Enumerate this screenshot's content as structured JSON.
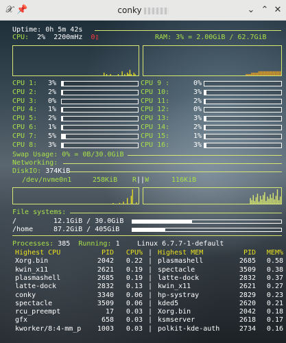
{
  "window": {
    "title": "conky"
  },
  "colors": {
    "label": "#a8e04a",
    "line": "#d8e870",
    "hot": "#e8e020",
    "alert": "#ff3a3a"
  },
  "uptime": {
    "label": "Uptime:",
    "value": "0h 5m 42s"
  },
  "cpu": {
    "label": "CPU:",
    "percent": "2%",
    "freq": "2200mHz",
    "temp": "0"
  },
  "ram": {
    "label": "RAM:",
    "value": "3% = 2.00GiB / 62.7GiB"
  },
  "graphs": {
    "cpu_history": [
      0,
      0,
      0,
      0,
      0,
      0,
      0,
      0,
      0,
      0,
      0,
      0,
      0,
      0,
      0,
      0,
      0,
      0,
      0,
      0,
      0,
      0,
      0,
      0,
      0,
      0,
      0,
      0,
      0,
      0,
      0,
      0,
      0,
      0,
      0,
      0,
      0,
      0,
      0,
      0,
      0,
      0,
      0,
      0,
      0,
      0,
      0,
      0,
      0,
      0,
      0,
      0,
      0,
      0,
      0,
      0,
      0,
      0,
      0,
      0,
      0,
      0,
      0,
      0,
      0,
      0,
      0,
      0,
      0,
      0,
      2,
      0,
      1,
      0,
      0,
      1,
      0,
      0,
      0,
      0,
      0,
      1,
      0,
      0,
      3,
      0,
      1,
      0,
      2,
      1,
      4,
      1,
      0,
      2,
      1,
      0,
      0
    ],
    "ram_history": [
      0,
      0,
      0,
      0,
      0,
      0,
      0,
      0,
      0,
      0,
      0,
      0,
      0,
      0,
      0,
      0,
      0,
      0,
      0,
      0,
      0,
      0,
      0,
      0,
      0,
      0,
      0,
      0,
      0,
      0,
      0,
      0,
      0,
      0,
      0,
      0,
      0,
      0,
      0,
      0,
      0,
      0,
      0,
      0,
      0,
      0,
      0,
      0,
      0,
      0,
      0,
      0,
      0,
      0,
      0,
      0,
      0,
      0,
      0,
      0,
      0,
      0,
      0,
      0,
      0,
      0,
      0,
      0,
      0,
      0,
      0,
      0,
      1,
      1,
      1,
      1,
      2,
      2,
      2,
      2,
      2,
      3,
      3,
      3,
      3,
      3,
      3,
      3,
      3,
      3,
      3,
      3,
      3,
      3,
      3,
      3,
      3
    ],
    "disk_read_history": [
      0,
      0,
      0,
      0,
      0,
      0,
      0,
      0,
      0,
      0,
      0,
      0,
      0,
      0,
      0,
      0,
      0,
      0,
      0,
      0,
      0,
      0,
      0,
      0,
      0,
      0,
      0,
      0,
      0,
      0,
      0,
      0,
      0,
      0,
      0,
      0,
      0,
      0,
      0,
      0,
      0,
      0,
      0,
      0,
      0,
      0,
      0,
      0,
      0,
      0,
      0,
      0,
      0,
      0,
      0,
      0,
      0,
      0,
      0,
      0,
      0,
      0,
      0,
      0,
      0,
      0,
      0,
      0,
      0,
      0,
      0,
      0,
      0,
      0,
      0,
      0,
      0,
      5,
      0,
      0,
      0,
      0,
      6,
      0,
      0,
      15,
      0,
      0,
      40,
      0,
      0,
      55,
      100,
      0,
      0,
      10,
      0
    ],
    "disk_write_history": [
      0,
      0,
      0,
      0,
      0,
      0,
      0,
      0,
      0,
      0,
      0,
      0,
      0,
      0,
      0,
      0,
      0,
      0,
      0,
      0,
      0,
      0,
      0,
      0,
      0,
      0,
      0,
      0,
      0,
      0,
      0,
      0,
      0,
      0,
      0,
      0,
      0,
      0,
      0,
      0,
      0,
      0,
      0,
      0,
      0,
      0,
      0,
      0,
      0,
      0,
      0,
      0,
      0,
      0,
      0,
      0,
      0,
      0,
      0,
      0,
      0,
      0,
      0,
      0,
      0,
      0,
      0,
      0,
      0,
      0,
      0,
      0,
      0,
      0,
      0,
      40,
      25,
      60,
      20,
      45,
      70,
      15,
      55,
      30,
      60,
      80,
      20,
      50,
      35,
      65,
      40,
      75,
      30,
      55,
      100,
      25,
      50
    ]
  },
  "cores_left": [
    {
      "label": "CPU 1:",
      "value": "3%",
      "level": 0.03
    },
    {
      "label": "CPU 2:",
      "value": "2%",
      "level": 0.02
    },
    {
      "label": "CPU 3:",
      "value": "0%",
      "level": 0.0
    },
    {
      "label": "CPU 4:",
      "value": "1%",
      "level": 0.01
    },
    {
      "label": "CPU 5:",
      "value": "2%",
      "level": 0.02
    },
    {
      "label": "CPU 6:",
      "value": "1%",
      "level": 0.01
    },
    {
      "label": "CPU 7:",
      "value": "5%",
      "level": 0.05
    },
    {
      "label": "CPU 8:",
      "value": "3%",
      "level": 0.03
    }
  ],
  "cores_right": [
    {
      "label": "CPU 9 :",
      "value": "0%",
      "level": 0.0
    },
    {
      "label": "CPU 10:",
      "value": "3%",
      "level": 0.03
    },
    {
      "label": "CPU 11:",
      "value": "2%",
      "level": 0.02
    },
    {
      "label": "CPU 12:",
      "value": "0%",
      "level": 0.0
    },
    {
      "label": "CPU 13:",
      "value": "3%",
      "level": 0.03
    },
    {
      "label": "CPU 14:",
      "value": "2%",
      "level": 0.02
    },
    {
      "label": "CPU 15:",
      "value": "1%",
      "level": 0.01
    },
    {
      "label": "CPU 16:",
      "value": "3%",
      "level": 0.03
    }
  ],
  "swap": {
    "label": "Swap Usage:",
    "value": "0% = 0B/30.0GiB"
  },
  "networking": {
    "label": "Networking:"
  },
  "diskio": {
    "label": "DiskIO:",
    "total": "374KiB",
    "device": "/dev/nvme0n1",
    "read": "258KiB",
    "read_flag": "R",
    "write_flag": "W",
    "write": "116KiB"
  },
  "filesystems": {
    "label": "File systems:",
    "items": [
      {
        "mount": "/",
        "used": "12.1GiB",
        "size": "30.0GiB",
        "level": 0.4
      },
      {
        "mount": "/home",
        "used": "87.2GiB",
        "size": "405GiB",
        "level": 0.22
      }
    ]
  },
  "processes": {
    "label": "Processes:",
    "count": "385",
    "running_label": "Running:",
    "running": "1",
    "kernel": "Linux 6.7.7-1-default"
  },
  "top_cpu": {
    "headers": [
      "Highest CPU",
      "PID",
      "CPU%"
    ],
    "rows": [
      [
        "Xorg.bin",
        "2042",
        "0.22"
      ],
      [
        "kwin_x11",
        "2621",
        "0.19"
      ],
      [
        "plasmashell",
        "2685",
        "0.19"
      ],
      [
        "latte-dock",
        "2832",
        "0.13"
      ],
      [
        "conky",
        "3340",
        "0.06"
      ],
      [
        "spectacle",
        "3509",
        "0.06"
      ],
      [
        "rcu_preempt",
        "17",
        "0.03"
      ],
      [
        "gfx",
        "658",
        "0.03"
      ],
      [
        "kworker/8:4-mm_p",
        "1003",
        "0.03"
      ]
    ]
  },
  "top_mem": {
    "headers": [
      "Highest MEM",
      "PID",
      "MEM%"
    ],
    "rows": [
      [
        "plasmashell",
        "2685",
        "0.58"
      ],
      [
        "spectacle",
        "3509",
        "0.38"
      ],
      [
        "latte-dock",
        "2832",
        "0.37"
      ],
      [
        "kwin_x11",
        "2621",
        "0.27"
      ],
      [
        "hp-systray",
        "2829",
        "0.23"
      ],
      [
        "kded5",
        "2620",
        "0.21"
      ],
      [
        "Xorg.bin",
        "2042",
        "0.18"
      ],
      [
        "ksmserver",
        "2618",
        "0.17"
      ],
      [
        "polkit-kde-auth",
        "2734",
        "0.16"
      ]
    ]
  }
}
